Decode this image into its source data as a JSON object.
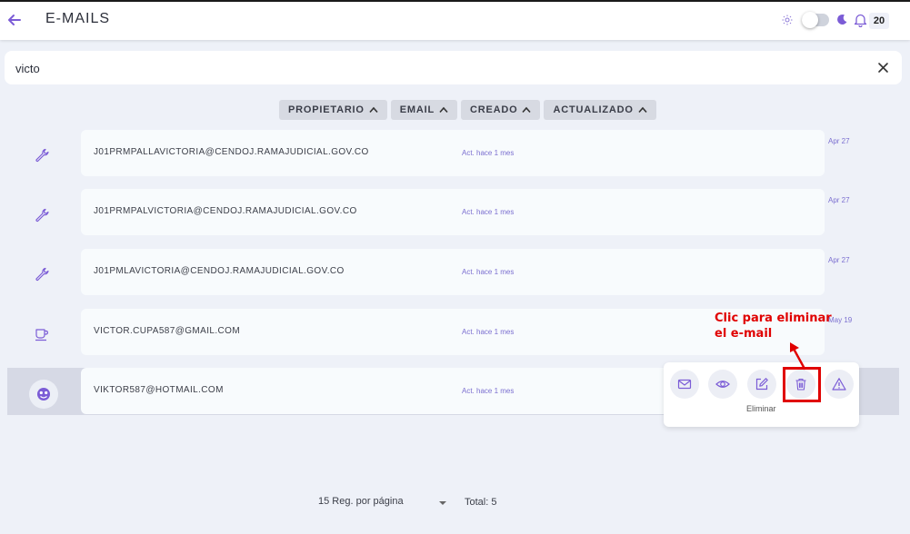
{
  "header": {
    "title": "E-MAILS",
    "notification_count": "20"
  },
  "search": {
    "value": "victo"
  },
  "sort_buttons": [
    {
      "label": "PROPIETARIO"
    },
    {
      "label": "EMAIL"
    },
    {
      "label": "CREADO"
    },
    {
      "label": "ACTUALIZADO"
    }
  ],
  "rows": [
    {
      "icon": "wrench-icon",
      "email": "J01PRMPALLAVICTORIA@CENDOJ.RAMAJUDICIAL.GOV.CO",
      "updated": "Act. hace 1 mes",
      "date": "Apr 27"
    },
    {
      "icon": "wrench-icon",
      "email": "J01PRMPALVICTORIA@CENDOJ.RAMAJUDICIAL.GOV.CO",
      "updated": "Act. hace 1 mes",
      "date": "Apr 27"
    },
    {
      "icon": "wrench-icon",
      "email": "J01PMLAVICTORIA@CENDOJ.RAMAJUDICIAL.GOV.CO",
      "updated": "Act. hace 1 mes",
      "date": "Apr 27"
    },
    {
      "icon": "coffee-icon",
      "email": "VICTOR.CUPA587@GMAIL.COM",
      "updated": "Act. hace 1 mes",
      "date": "May 19"
    },
    {
      "icon": "avatar-icon",
      "email": "VIKTOR587@HOTMAIL.COM",
      "updated": "Act. hace 1 mes",
      "date": ""
    }
  ],
  "actions": {
    "buttons": [
      "mail-icon",
      "eye-icon",
      "edit-icon",
      "trash-icon",
      "warning-icon"
    ],
    "hover_label": "Eliminar"
  },
  "annotation": {
    "line1": "Clic para eliminar",
    "line2": "el e-mail",
    "color": "#e00000"
  },
  "pagination": {
    "per_page": "15 Reg. por página",
    "total": "Total: 5"
  },
  "colors": {
    "accent": "#7b5cd6",
    "background": "#eef1f8",
    "card": "#f8fbfd"
  }
}
